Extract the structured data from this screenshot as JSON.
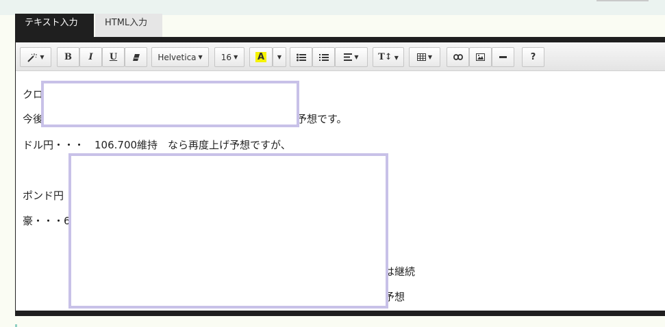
{
  "tabs": {
    "text_input": "テキスト入力",
    "html_input": "HTML入力"
  },
  "toolbar": {
    "style_icon": "magic-wand-icon",
    "bold": "B",
    "italic": "I",
    "underline": "U",
    "font_name": "Helvetica",
    "font_size": "16",
    "font_color": "A",
    "help": "?"
  },
  "content": {
    "line1": "クロ",
    "line2_start": "今後",
    "line2_end": "予想です。",
    "line3": "ドル円・・・　106.700維持　なら再度上げ予想ですが、",
    "line4": "ポンド円",
    "line5": "豪・・・6",
    "line6_end": "は継続",
    "line7_end": "予想"
  },
  "colors": {
    "redaction_border": "#c8c1e8",
    "tab_active_bg": "#1f1f1f",
    "highlight_yellow": "#f5f300"
  }
}
